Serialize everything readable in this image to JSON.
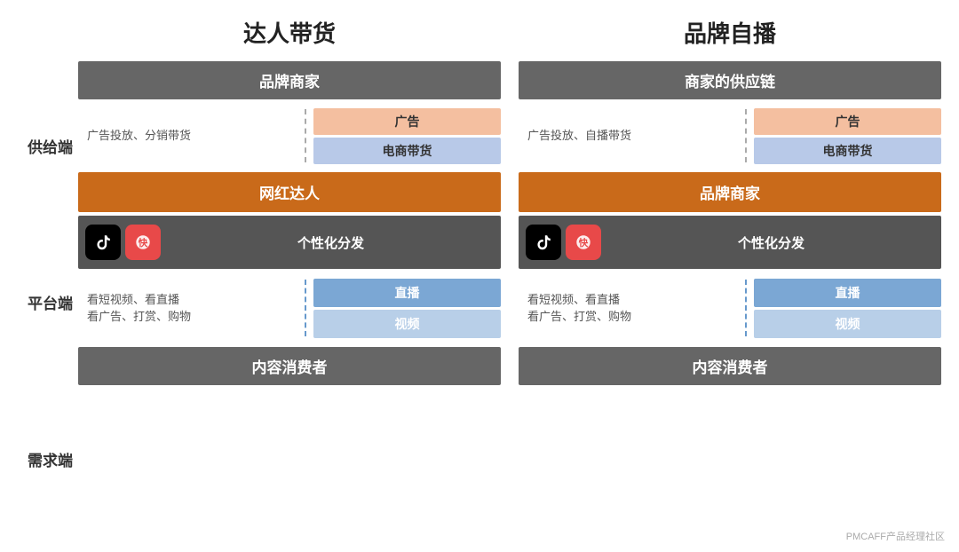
{
  "titles": {
    "left": "达人带货",
    "right": "品牌自播"
  },
  "side_labels": {
    "supply": "供给端",
    "platform": "平台端",
    "demand": "需求端"
  },
  "left_diagram": {
    "top_brand": "品牌商家",
    "supply_left_text": "广告投放、分销带货",
    "supply_ad": "广告",
    "supply_ecom": "电商带货",
    "influencer_row": "网红达人",
    "platform_text": "个性化分发",
    "demand_left_text": "看短视频、看直播\n看广告、打赏、购物",
    "demand_live": "直播",
    "demand_video": "视频",
    "bottom_consumer": "内容消费者"
  },
  "right_diagram": {
    "top_brand": "商家的供应链",
    "supply_left_text": "广告投放、自播带货",
    "supply_ad": "广告",
    "supply_ecom": "电商带货",
    "influencer_row": "品牌商家",
    "platform_text": "个性化分发",
    "demand_left_text": "看短视频、看直播\n看广告、打赏、购物",
    "demand_live": "直播",
    "demand_video": "视频",
    "bottom_consumer": "内容消费者"
  },
  "watermark": "PMCAFF产品经理社区"
}
